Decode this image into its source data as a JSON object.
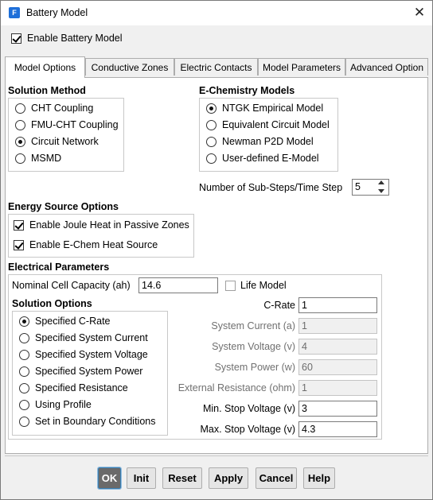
{
  "window": {
    "title": "Battery Model",
    "icon": "fluent-app-icon",
    "close_symbol": "✕"
  },
  "enable_battery": {
    "label": "Enable Battery Model",
    "checked": true
  },
  "tabs": [
    {
      "label": "Model Options",
      "active": true
    },
    {
      "label": "Conductive Zones",
      "active": false
    },
    {
      "label": "Electric Contacts",
      "active": false
    },
    {
      "label": "Model Parameters",
      "active": false
    },
    {
      "label": "Advanced Option",
      "active": false
    }
  ],
  "solution_method": {
    "title": "Solution Method",
    "options": [
      "CHT Coupling",
      "FMU-CHT Coupling",
      "Circuit Network",
      "MSMD"
    ],
    "selected": "Circuit Network"
  },
  "echem_models": {
    "title": "E-Chemistry Models",
    "options": [
      "NTGK Empirical Model",
      "Equivalent Circuit Model",
      "Newman P2D Model",
      "User-defined E-Model"
    ],
    "selected": "NTGK Empirical Model"
  },
  "sub_steps": {
    "label": "Number of Sub-Steps/Time Step",
    "value": "5"
  },
  "energy_source": {
    "title": "Energy Source Options",
    "joule_label": "Enable Joule Heat in Passive Zones",
    "joule_checked": true,
    "echem_label": "Enable E-Chem Heat Source",
    "echem_checked": true
  },
  "electrical": {
    "title": "Electrical Parameters",
    "capacity_label": "Nominal Cell Capacity  (ah)",
    "capacity_value": "14.6",
    "life_model_label": "Life Model",
    "life_model_checked": false
  },
  "solution_options": {
    "title": "Solution Options",
    "options": [
      "Specified C-Rate",
      "Specified System Current",
      "Specified System Voltage",
      "Specified System Power",
      "Specified Resistance",
      "Using Profile",
      "Set in Boundary Conditions"
    ],
    "selected": "Specified C-Rate"
  },
  "params": {
    "c_rate": {
      "label": "C-Rate",
      "value": "1"
    },
    "system_current": {
      "label": "System Current  (a)",
      "value": "1"
    },
    "system_voltage": {
      "label": "System Voltage  (v)",
      "value": "4"
    },
    "system_power": {
      "label": "System Power  (w)",
      "value": "60"
    },
    "external_resistance": {
      "label": "External Resistance  (ohm)",
      "value": "1"
    },
    "min_stop_voltage": {
      "label": "Min. Stop Voltage  (v)",
      "value": "3"
    },
    "max_stop_voltage": {
      "label": "Max. Stop Voltage  (v)",
      "value": "4.3"
    }
  },
  "buttons": {
    "ok": "OK",
    "init": "Init",
    "reset": "Reset",
    "apply": "Apply",
    "cancel": "Cancel",
    "help": "Help"
  }
}
